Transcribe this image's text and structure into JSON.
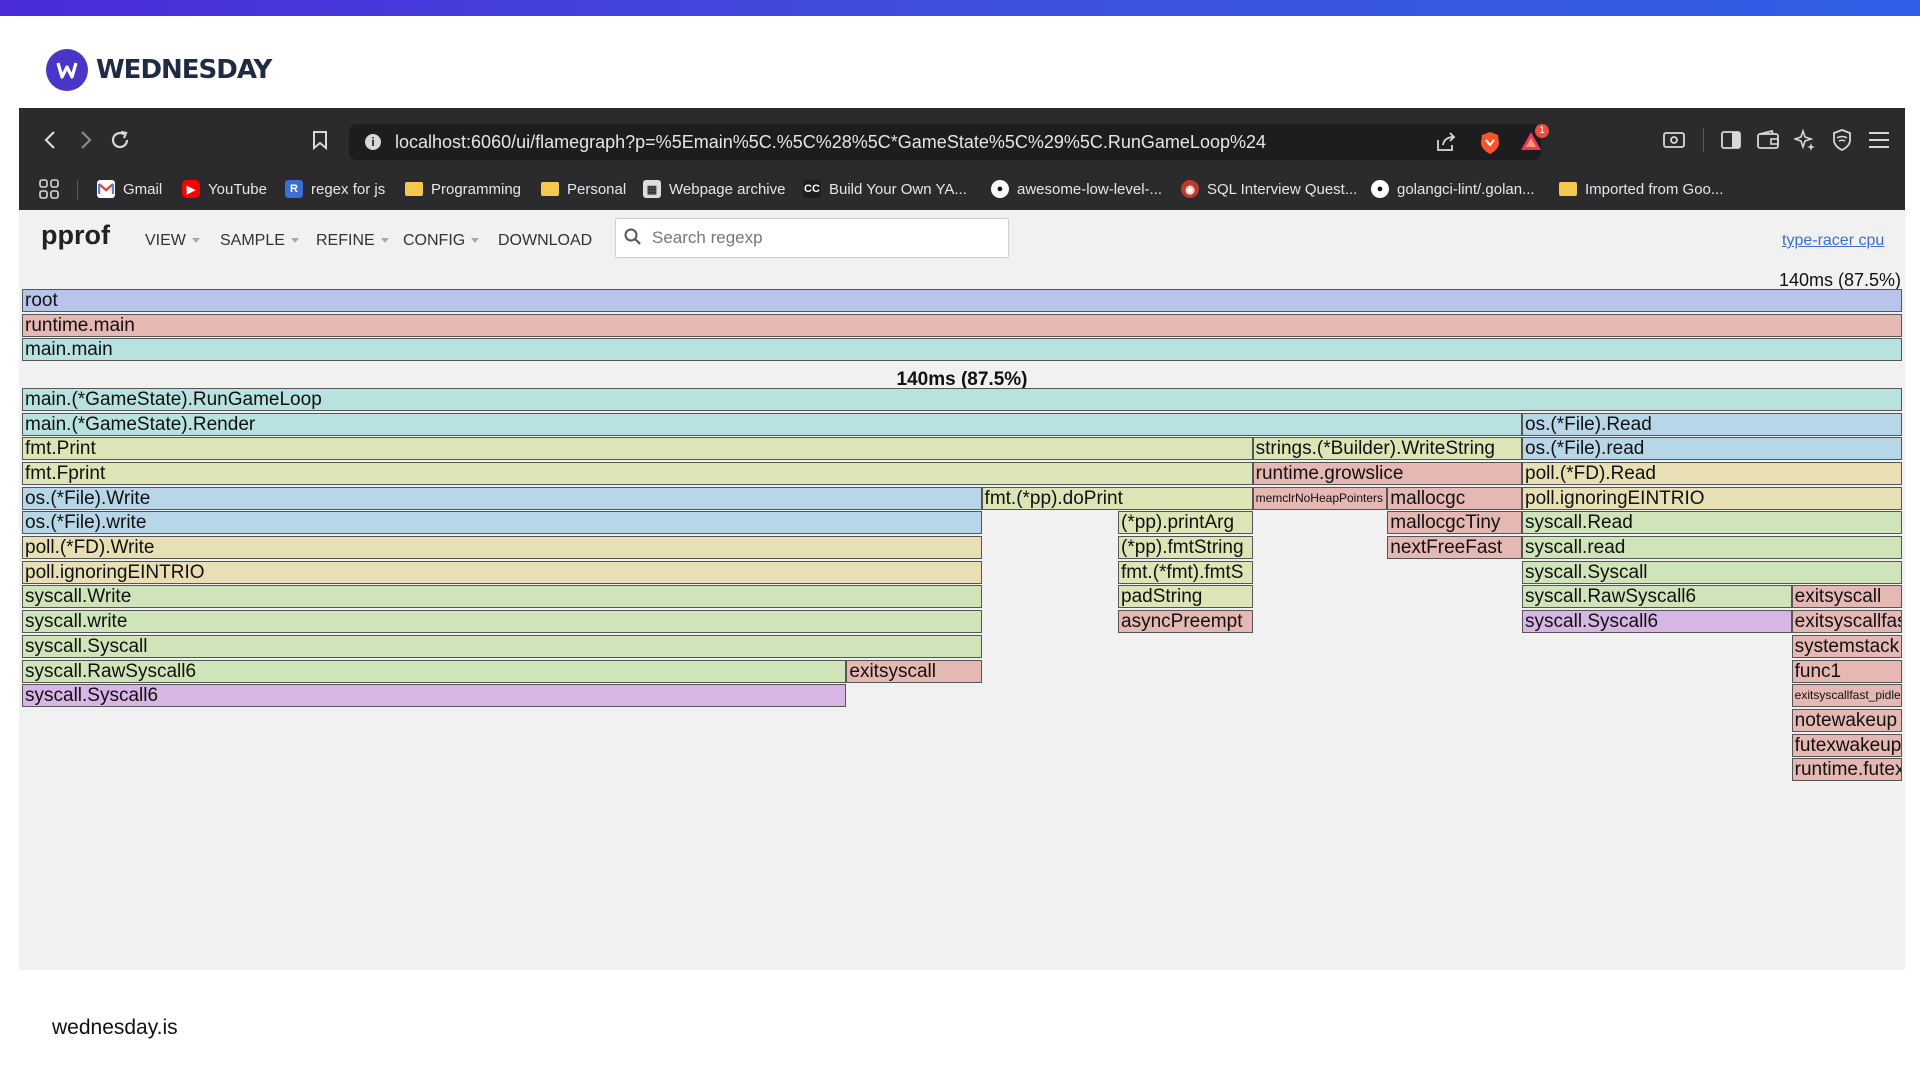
{
  "brand": {
    "name": "WEDNESDAY",
    "site": "wednesday.is"
  },
  "browser": {
    "url": "localhost:6060/ui/flamegraph?p=%5Emain%5C.%5C%28%5C*GameState%5C%29%5C.RunGameLoop%24",
    "notification_count": "1",
    "bookmarks": [
      {
        "label": "Gmail",
        "icon": "gmail-icon"
      },
      {
        "label": "YouTube",
        "icon": "youtube-icon"
      },
      {
        "label": "regex for js",
        "icon": "r-icon"
      },
      {
        "label": "Programming",
        "icon": "folder-icon"
      },
      {
        "label": "Personal",
        "icon": "folder-icon"
      },
      {
        "label": "Webpage archive",
        "icon": "archive-icon"
      },
      {
        "label": "Build Your Own YA...",
        "icon": "cc-icon"
      },
      {
        "label": "awesome-low-level-...",
        "icon": "github-icon"
      },
      {
        "label": "SQL Interview Quest...",
        "icon": "owl-icon"
      },
      {
        "label": "golangci-lint/.golan...",
        "icon": "github-icon"
      },
      {
        "label": "Imported from Goo...",
        "icon": "folder-icon"
      }
    ]
  },
  "pprof": {
    "title": "pprof",
    "menus": [
      "VIEW",
      "SAMPLE",
      "REFINE",
      "CONFIG",
      "DOWNLOAD"
    ],
    "search_placeholder": "Search regexp",
    "profile_link": "type-racer cpu",
    "total": "140ms (87.5%)",
    "hover_label": "140ms (87.5%)"
  },
  "colors": {
    "blue_purple": "#b9c4ec",
    "pink": "#e6b8b3",
    "teal": "#b8e2df",
    "yellow_green": "#dbe5b5",
    "light_blue": "#b7d7e8",
    "tan": "#e8e0b4",
    "purple": "#d7b6e6",
    "green": "#cfe4b8"
  },
  "frames": [
    {
      "name": "root",
      "row": 0,
      "start": 0,
      "width": 1,
      "color": "blue_purple"
    },
    {
      "name": "runtime.main",
      "row": 1,
      "start": 0,
      "width": 1,
      "color": "pink"
    },
    {
      "name": "main.main",
      "row": 2,
      "start": 0,
      "width": 1,
      "color": "teal"
    },
    {
      "name": "main.(*GameState).RunGameLoop",
      "row": 4,
      "start": 0,
      "width": 1,
      "color": "teal"
    },
    {
      "name": "main.(*GameState).Render",
      "row": 5,
      "start": 0,
      "width": 0.7979,
      "color": "teal"
    },
    {
      "name": "os.(*File).Read",
      "row": 5,
      "start": 0.7979,
      "width": 0.2021,
      "color": "light_blue"
    },
    {
      "name": "fmt.Print",
      "row": 6,
      "start": 0,
      "width": 0.6546,
      "color": "yellow_green"
    },
    {
      "name": "strings.(*Builder).WriteString",
      "row": 6,
      "start": 0.6546,
      "width": 0.1433,
      "color": "yellow_green"
    },
    {
      "name": "os.(*File).read",
      "row": 6,
      "start": 0.7979,
      "width": 0.2021,
      "color": "light_blue"
    },
    {
      "name": "fmt.Fprint",
      "row": 7,
      "start": 0,
      "width": 0.6546,
      "color": "yellow_green"
    },
    {
      "name": "runtime.growslice",
      "row": 7,
      "start": 0.6546,
      "width": 0.1433,
      "color": "pink"
    },
    {
      "name": "poll.(*FD).Read",
      "row": 7,
      "start": 0.7979,
      "width": 0.2021,
      "color": "tan"
    },
    {
      "name": "os.(*File).Write",
      "row": 8,
      "start": 0,
      "width": 0.5104,
      "color": "light_blue"
    },
    {
      "name": "fmt.(*pp).doPrint",
      "row": 8,
      "start": 0.5104,
      "width": 0.1442,
      "color": "yellow_green"
    },
    {
      "name": "memclrNoHeapPointers",
      "row": 8,
      "start": 0.6546,
      "width": 0.0716,
      "color": "pink",
      "small": true
    },
    {
      "name": "mallocgc",
      "row": 8,
      "start": 0.7262,
      "width": 0.0717,
      "color": "pink"
    },
    {
      "name": "poll.ignoringEINTRIO",
      "row": 8,
      "start": 0.7979,
      "width": 0.2021,
      "color": "tan"
    },
    {
      "name": "os.(*File).write",
      "row": 9,
      "start": 0,
      "width": 0.5104,
      "color": "light_blue"
    },
    {
      "name": "(*pp).printArg",
      "row": 9,
      "start": 0.583,
      "width": 0.0716,
      "color": "yellow_green"
    },
    {
      "name": "mallocgcTiny",
      "row": 9,
      "start": 0.7262,
      "width": 0.0717,
      "color": "pink"
    },
    {
      "name": "syscall.Read",
      "row": 9,
      "start": 0.7979,
      "width": 0.2021,
      "color": "green"
    },
    {
      "name": "poll.(*FD).Write",
      "row": 10,
      "start": 0,
      "width": 0.5104,
      "color": "tan"
    },
    {
      "name": "(*pp).fmtString",
      "row": 10,
      "start": 0.583,
      "width": 0.0716,
      "color": "yellow_green"
    },
    {
      "name": "nextFreeFast",
      "row": 10,
      "start": 0.7262,
      "width": 0.0717,
      "color": "pink"
    },
    {
      "name": "syscall.read",
      "row": 10,
      "start": 0.7979,
      "width": 0.2021,
      "color": "green"
    },
    {
      "name": "poll.ignoringEINTRIO",
      "row": 11,
      "start": 0,
      "width": 0.5104,
      "color": "tan"
    },
    {
      "name": "fmt.(*fmt).fmtS",
      "row": 11,
      "start": 0.583,
      "width": 0.0716,
      "color": "yellow_green"
    },
    {
      "name": "syscall.Syscall",
      "row": 11,
      "start": 0.7979,
      "width": 0.2021,
      "color": "green"
    },
    {
      "name": "syscall.Write",
      "row": 12,
      "start": 0,
      "width": 0.5104,
      "color": "green"
    },
    {
      "name": "padString",
      "row": 12,
      "start": 0.583,
      "width": 0.0716,
      "color": "yellow_green"
    },
    {
      "name": "syscall.RawSyscall6",
      "row": 12,
      "start": 0.7979,
      "width": 0.1434,
      "color": "green"
    },
    {
      "name": "exitsyscall",
      "row": 12,
      "start": 0.9413,
      "width": 0.0587,
      "color": "pink"
    },
    {
      "name": "syscall.write",
      "row": 13,
      "start": 0,
      "width": 0.5104,
      "color": "green"
    },
    {
      "name": "asyncPreempt",
      "row": 13,
      "start": 0.583,
      "width": 0.0716,
      "color": "pink"
    },
    {
      "name": "syscall.Syscall6",
      "row": 13,
      "start": 0.7979,
      "width": 0.1434,
      "color": "purple"
    },
    {
      "name": "exitsyscallfast",
      "row": 13,
      "start": 0.9413,
      "width": 0.0587,
      "color": "pink"
    },
    {
      "name": "syscall.Syscall",
      "row": 14,
      "start": 0,
      "width": 0.5104,
      "color": "green"
    },
    {
      "name": "systemstack",
      "row": 14,
      "start": 0.9413,
      "width": 0.0587,
      "color": "pink"
    },
    {
      "name": "syscall.RawSyscall6",
      "row": 15,
      "start": 0,
      "width": 0.4385,
      "color": "green"
    },
    {
      "name": "exitsyscall",
      "row": 15,
      "start": 0.4385,
      "width": 0.0719,
      "color": "pink"
    },
    {
      "name": "func1",
      "row": 15,
      "start": 0.9413,
      "width": 0.0587,
      "color": "pink"
    },
    {
      "name": "syscall.Syscall6",
      "row": 16,
      "start": 0,
      "width": 0.4385,
      "color": "purple"
    },
    {
      "name": "exitsyscallfast_pidle",
      "row": 16,
      "start": 0.9413,
      "width": 0.0587,
      "color": "pink",
      "small": true
    },
    {
      "name": "notewakeup",
      "row": 17,
      "start": 0.9413,
      "width": 0.0587,
      "color": "pink"
    },
    {
      "name": "futexwakeup",
      "row": 18,
      "start": 0.9413,
      "width": 0.0587,
      "color": "pink"
    },
    {
      "name": "runtime.futex",
      "row": 19,
      "start": 0.9413,
      "width": 0.0587,
      "color": "pink"
    }
  ]
}
